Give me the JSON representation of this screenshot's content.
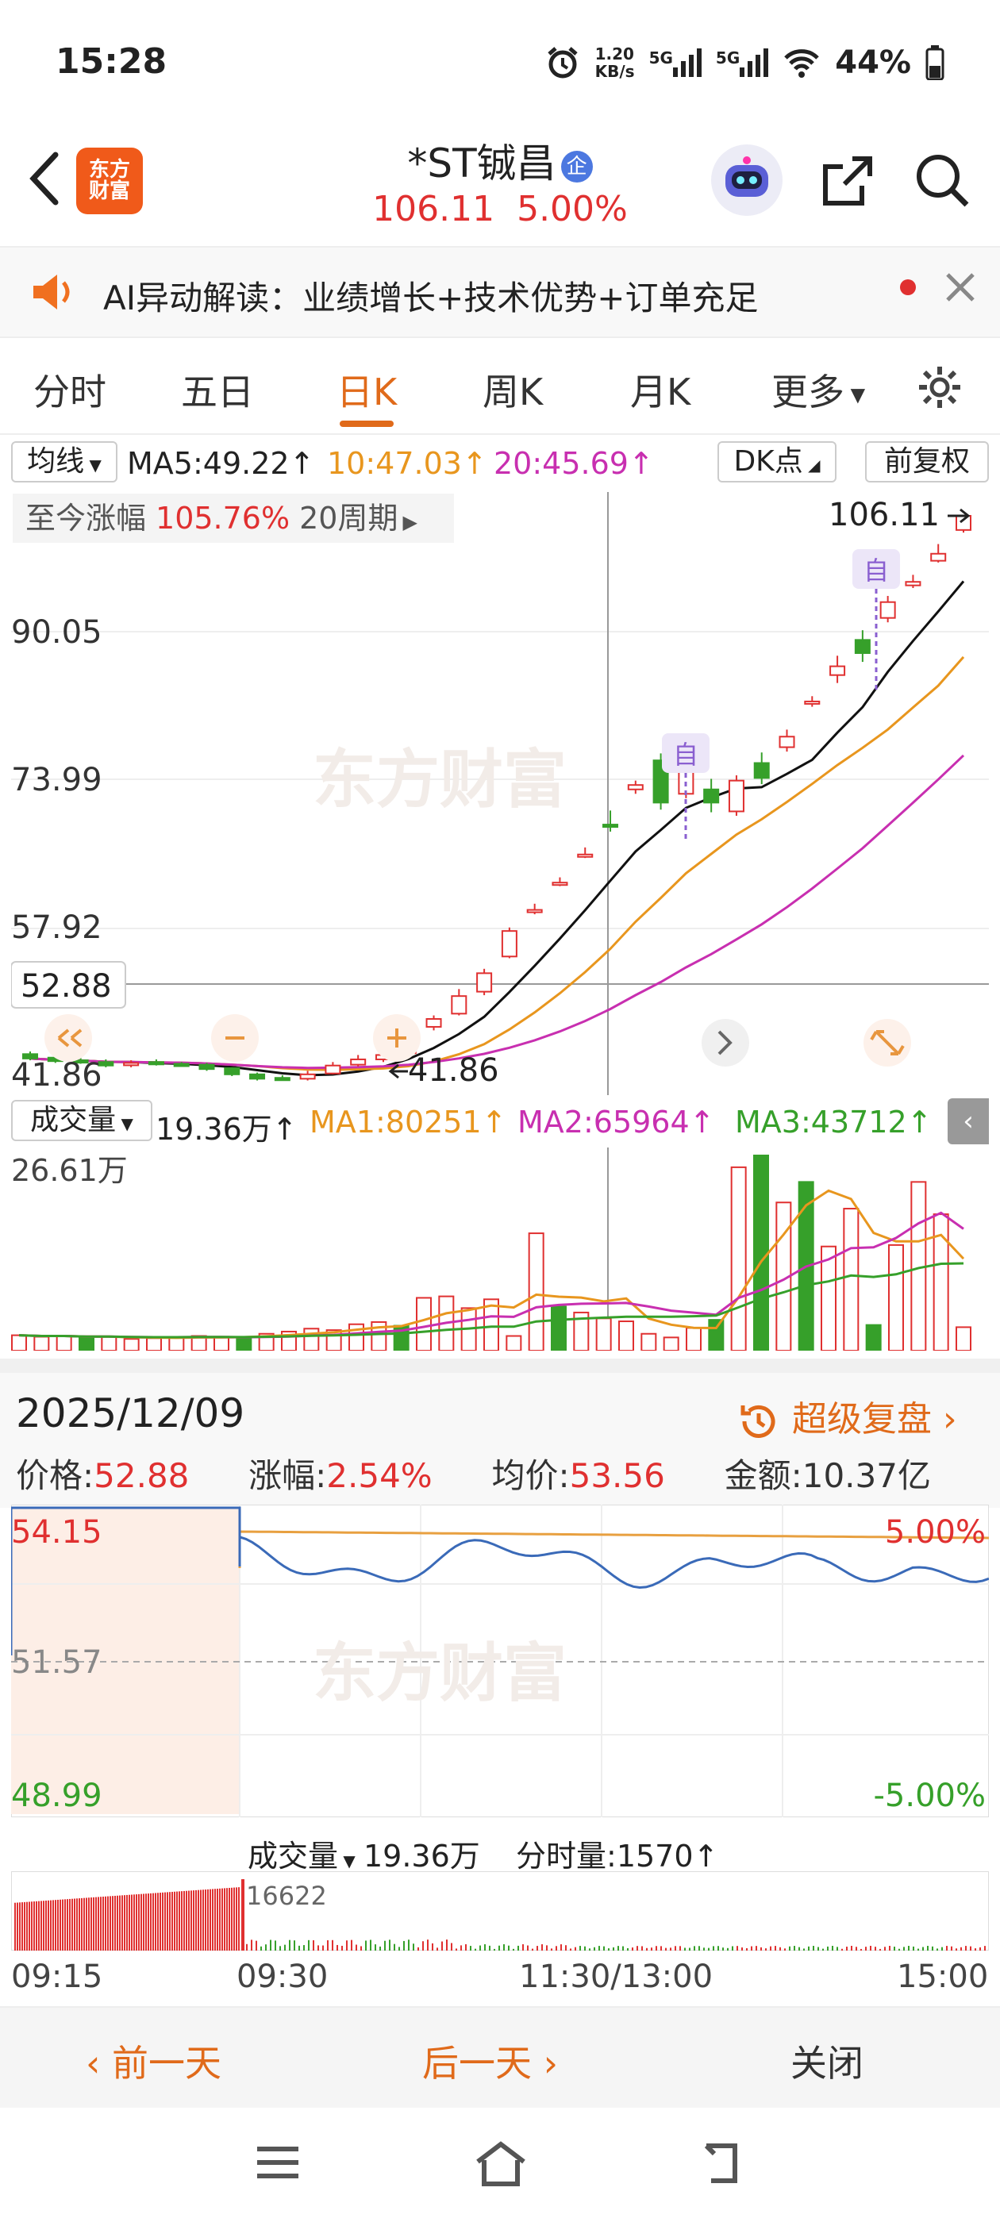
{
  "status": {
    "time": "15:28",
    "netspeed_top": "1.20",
    "netspeed_bottom": "KB/s",
    "sig1": "5G",
    "sig2": "5G",
    "battery": "44%"
  },
  "header": {
    "logo_top": "东方",
    "logo_bottom": "财富",
    "stock_name": "*ST铖昌",
    "badge": "企",
    "price": "106.11",
    "change": "5.00%"
  },
  "ai_bar": {
    "text": "AI异动解读：业绩增长+技术优势+订单充足"
  },
  "tabs": [
    "分时",
    "五日",
    "日K",
    "周K",
    "月K",
    "更多"
  ],
  "active_tab": "日K",
  "ma_row": {
    "selector": "均线",
    "ma5": "MA5:49.22↑",
    "ma10": "10:47.03↑",
    "ma20": "20:45.69↑",
    "dk": "DK点",
    "adjust": "前复权"
  },
  "kline": {
    "range_label": "至今涨幅",
    "range_value": "105.76%",
    "range_period": "20周期",
    "y_labels": [
      "90.05",
      "73.99",
      "57.92",
      "41.86"
    ],
    "crosshair_price": "52.88",
    "high_label": "106.11",
    "low_label": "41.86",
    "marker_label": "自",
    "watermark": "东方财富"
  },
  "volume": {
    "selector": "成交量",
    "value": "19.36万↑",
    "ma1": "MA1:80251↑",
    "ma2": "MA2:65964↑",
    "ma3": "MA3:43712↑",
    "top_label": "26.61万"
  },
  "detail": {
    "date": "2025/12/09",
    "replay": "超级复盘",
    "price_label": "价格:",
    "price": "52.88",
    "chg_label": "涨幅:",
    "chg": "2.54%",
    "avg_label": "均价:",
    "avg": "53.56",
    "amt_label": "金额:",
    "amt": "10.37亿"
  },
  "intraday": {
    "y_top": "54.15",
    "y_mid": "51.57",
    "y_bottom": "48.99",
    "pct_top": "5.00%",
    "pct_bottom": "-5.00%",
    "vol_selector": "成交量",
    "vol_value": "19.36万",
    "tick_label": "分时量:",
    "tick_value": "1570↑",
    "vol_peak": "16622",
    "time_labels": [
      "09:15",
      "09:30",
      "11:30/13:00",
      "15:00"
    ]
  },
  "footer": {
    "prev": "前一天",
    "next": "后一天",
    "close": "关闭"
  },
  "colors": {
    "up": "#e03030",
    "down": "#36a02a",
    "accent": "#e06a1a",
    "ma5": "#111111",
    "ma10": "#e8961e",
    "ma20": "#c82fb0"
  }
}
